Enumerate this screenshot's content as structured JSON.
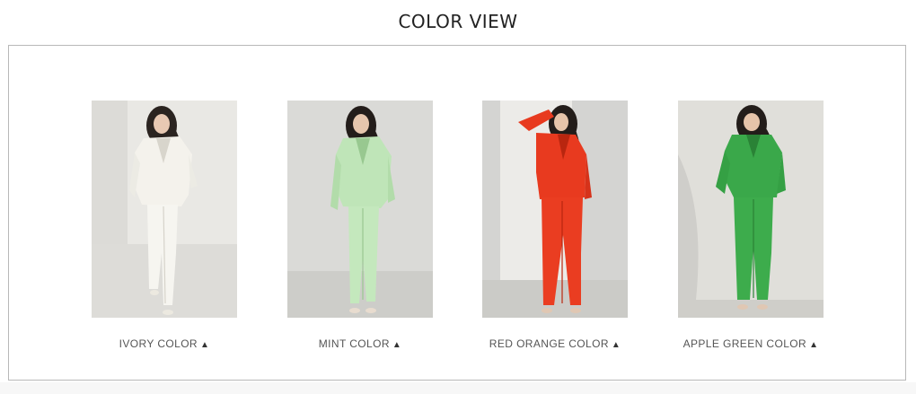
{
  "section": {
    "title": "COLOR VIEW"
  },
  "colors": [
    {
      "label": "IVORY COLOR",
      "arrow": "▲",
      "suit": "#f3f1ea",
      "suit_shade": "#d9d6cc",
      "backdrop": "#e6e5e1",
      "floor": "#d9d8d4"
    },
    {
      "label": "MINT COLOR",
      "arrow": "▲",
      "suit": "#bfe5b8",
      "suit_shade": "#98c890",
      "backdrop": "#d9d9d6",
      "floor": "#cfcfcb"
    },
    {
      "label": "RED ORANGE COLOR",
      "arrow": "▲",
      "suit": "#e83a1f",
      "suit_shade": "#b9260f",
      "backdrop": "#dcdcda",
      "floor": "#cfcfcb"
    },
    {
      "label": "APPLE GREEN COLOR",
      "arrow": "▲",
      "suit": "#3aa84a",
      "suit_shade": "#2a8236",
      "backdrop": "#deddd8",
      "floor": "#d2d1cc"
    }
  ]
}
